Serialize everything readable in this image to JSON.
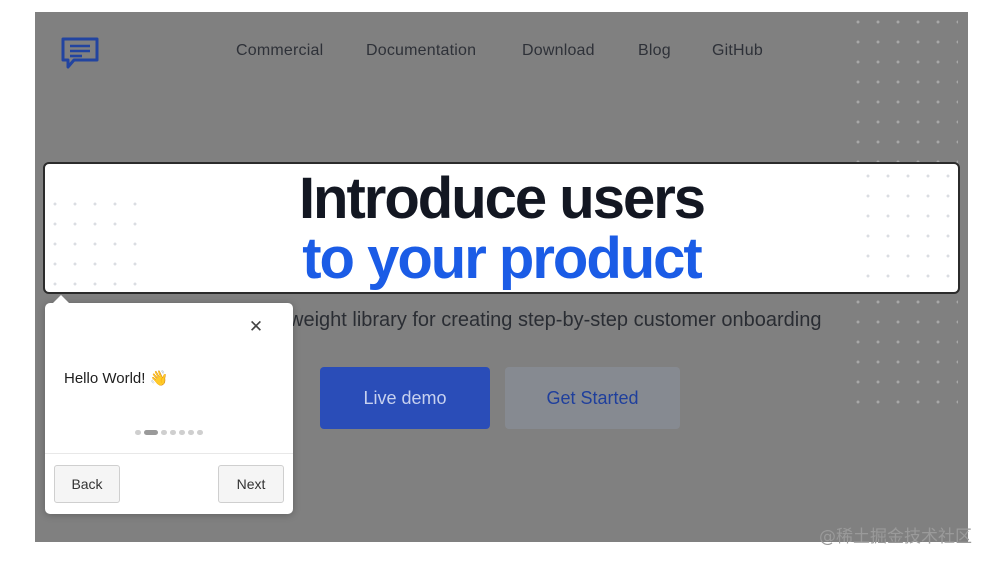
{
  "nav": {
    "logo_icon": "chat-bubble-icon",
    "items": [
      "Commercial",
      "Documentation",
      "Download",
      "Blog",
      "GitHub"
    ]
  },
  "hero": {
    "line1": "Introduce users",
    "line2": "to your product",
    "subtitle": "weight library for creating step-by-step customer onboarding"
  },
  "actions": {
    "live_demo": "Live demo",
    "get_started": "Get Started"
  },
  "popover": {
    "close_icon": "close-icon",
    "close_glyph": "✕",
    "message": "Hello World!",
    "emoji": "👋",
    "steps_total": 7,
    "active_step": 2,
    "back_label": "Back",
    "next_label": "Next"
  },
  "watermark": "@稀土掘金技术社区",
  "colors": {
    "accent": "#1b5ce6",
    "overlay": "#808080",
    "primary_button": "#2a4db8"
  }
}
